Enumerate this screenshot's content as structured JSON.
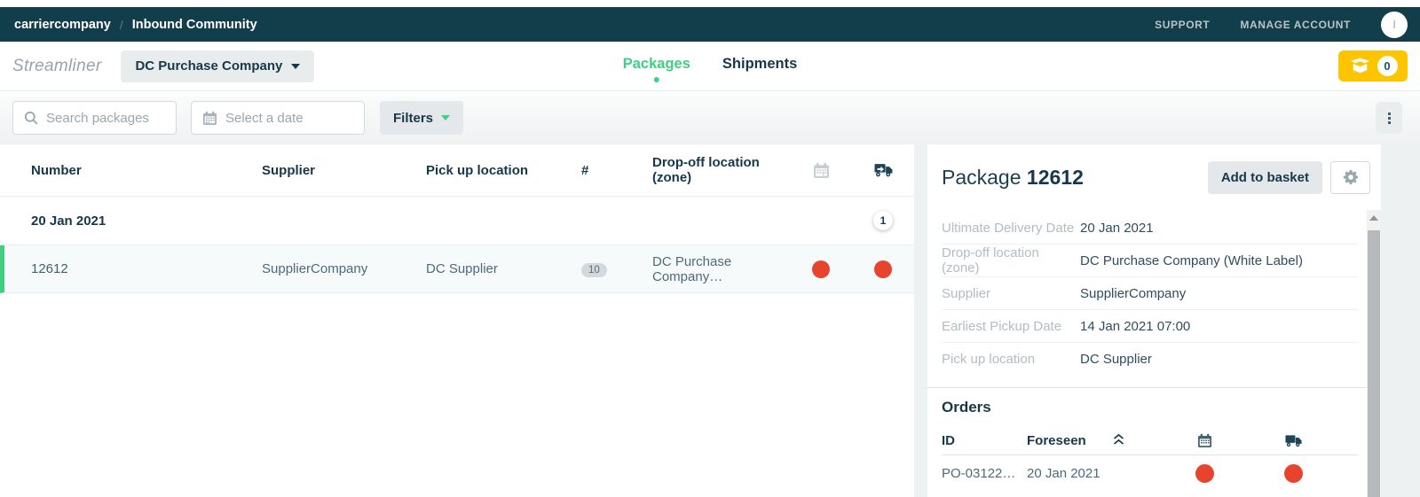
{
  "navbar": {
    "brand": "carriercompany",
    "separator": "/",
    "section": "Inbound Community",
    "support": "SUPPORT",
    "manage_account": "MANAGE ACCOUNT",
    "avatar_initial": "I"
  },
  "header": {
    "logo": "Streamliner",
    "company_selector": "DC Purchase Company",
    "tabs": {
      "packages": "Packages",
      "shipments": "Shipments"
    },
    "basket_count": "0"
  },
  "toolbar": {
    "search_placeholder": "Search packages",
    "date_placeholder": "Select a date",
    "filters_label": "Filters"
  },
  "packages_table": {
    "columns": {
      "number": "Number",
      "supplier": "Supplier",
      "pickup": "Pick up location",
      "count": "#",
      "dropoff": "Drop-off location (zone)"
    },
    "group": {
      "date": "20 Jan 2021",
      "count": "1"
    },
    "rows": [
      {
        "number": "12612",
        "supplier": "SupplierCompany",
        "pickup": "DC Supplier",
        "count": "10",
        "dropoff": "DC Purchase Company…",
        "calendar_status": "red",
        "transport_status": "red"
      }
    ]
  },
  "detail": {
    "title_prefix": "Package",
    "title_number": "12612",
    "add_to_basket_label": "Add to basket",
    "fields": [
      {
        "label": "Ultimate Delivery Date",
        "value": "20 Jan 2021"
      },
      {
        "label": "Drop-off location (zone)",
        "value": "DC Purchase Company (White Label)"
      },
      {
        "label": "Supplier",
        "value": "SupplierCompany"
      },
      {
        "label": "Earliest Pickup Date",
        "value": "14 Jan 2021 07:00"
      },
      {
        "label": "Pick up location",
        "value": "DC Supplier"
      }
    ],
    "orders": {
      "heading": "Orders",
      "columns": {
        "id": "ID",
        "foreseen": "Foreseen"
      },
      "rows": [
        {
          "id": "PO-03122…",
          "foreseen": "20 Jan 2021",
          "calendar_status": "red",
          "transport_status": "red"
        }
      ]
    }
  },
  "icons": {
    "search": "magnifier",
    "calendar": "calendar-grid",
    "truck": "delivery-truck",
    "gear": "gear",
    "kebab": "vertical-dots",
    "basket": "open-box",
    "sort": "double-chevron-up",
    "caret": "triangle-down",
    "status_dot": "filled-circle",
    "scroll_up": "triangle-up"
  },
  "colors": {
    "navbar_bg": "#123d4b",
    "accent_green": "#3ecf81",
    "basket_yellow": "#fdc500",
    "status_red": "#e8432d",
    "heading_navy": "#16384a",
    "muted_label": "#b2bcc2",
    "selected_row_bg": "#f7fafb"
  }
}
